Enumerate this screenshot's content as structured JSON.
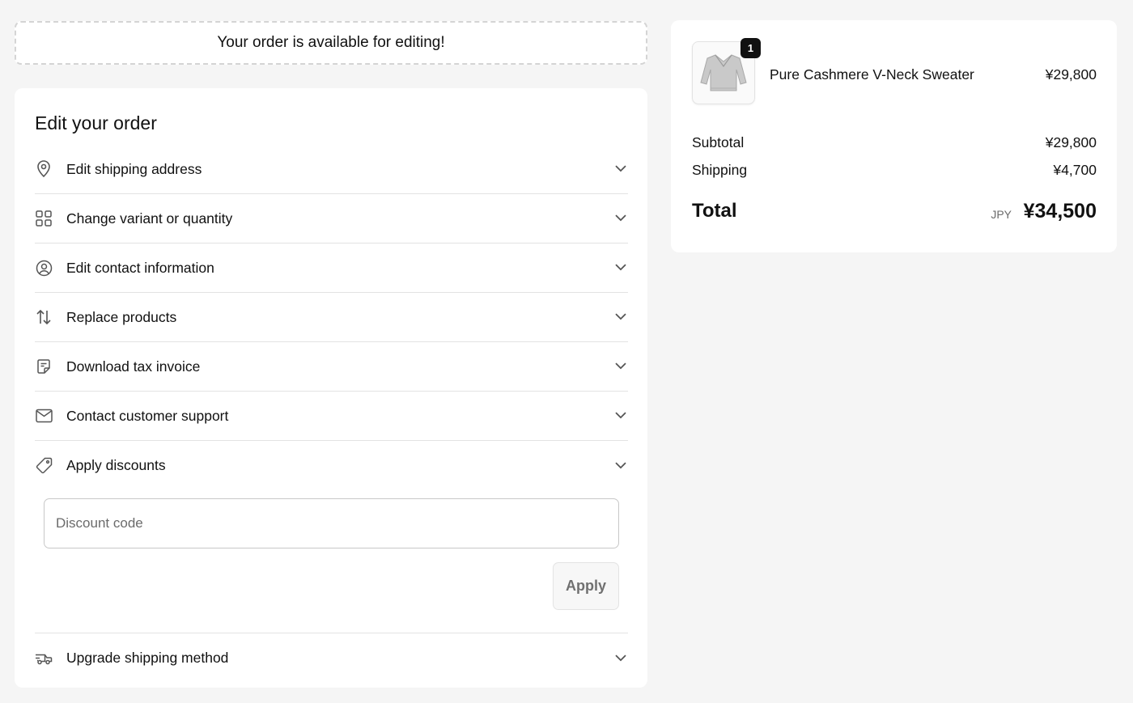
{
  "banner": {
    "text": "Your order is available for editing!"
  },
  "edit_order": {
    "title": "Edit your order",
    "rows": [
      {
        "label": "Edit shipping address",
        "icon": "map-pin-icon"
      },
      {
        "label": "Change variant or quantity",
        "icon": "grid-icon"
      },
      {
        "label": "Edit contact information",
        "icon": "user-circle-icon"
      },
      {
        "label": "Replace products",
        "icon": "arrows-up-down-icon"
      },
      {
        "label": "Download tax invoice",
        "icon": "receipt-icon"
      },
      {
        "label": "Contact customer support",
        "icon": "envelope-icon"
      },
      {
        "label": "Apply discounts",
        "icon": "tag-icon"
      },
      {
        "label": "Upgrade shipping method",
        "icon": "truck-icon"
      }
    ],
    "discount": {
      "placeholder": "Discount code",
      "value": "",
      "apply_label": "Apply"
    }
  },
  "summary": {
    "product": {
      "name": "Pure Cashmere V-Neck Sweater",
      "price": "¥29,800",
      "quantity": "1"
    },
    "subtotal_label": "Subtotal",
    "subtotal_value": "¥29,800",
    "shipping_label": "Shipping",
    "shipping_value": "¥4,700",
    "total_label": "Total",
    "total_currency": "JPY",
    "total_value": "¥34,500"
  },
  "colors": {
    "background": "#f5f5f5",
    "card": "#ffffff",
    "text": "#111111",
    "muted": "#6b6b6b",
    "divider": "#e3e3e3"
  }
}
